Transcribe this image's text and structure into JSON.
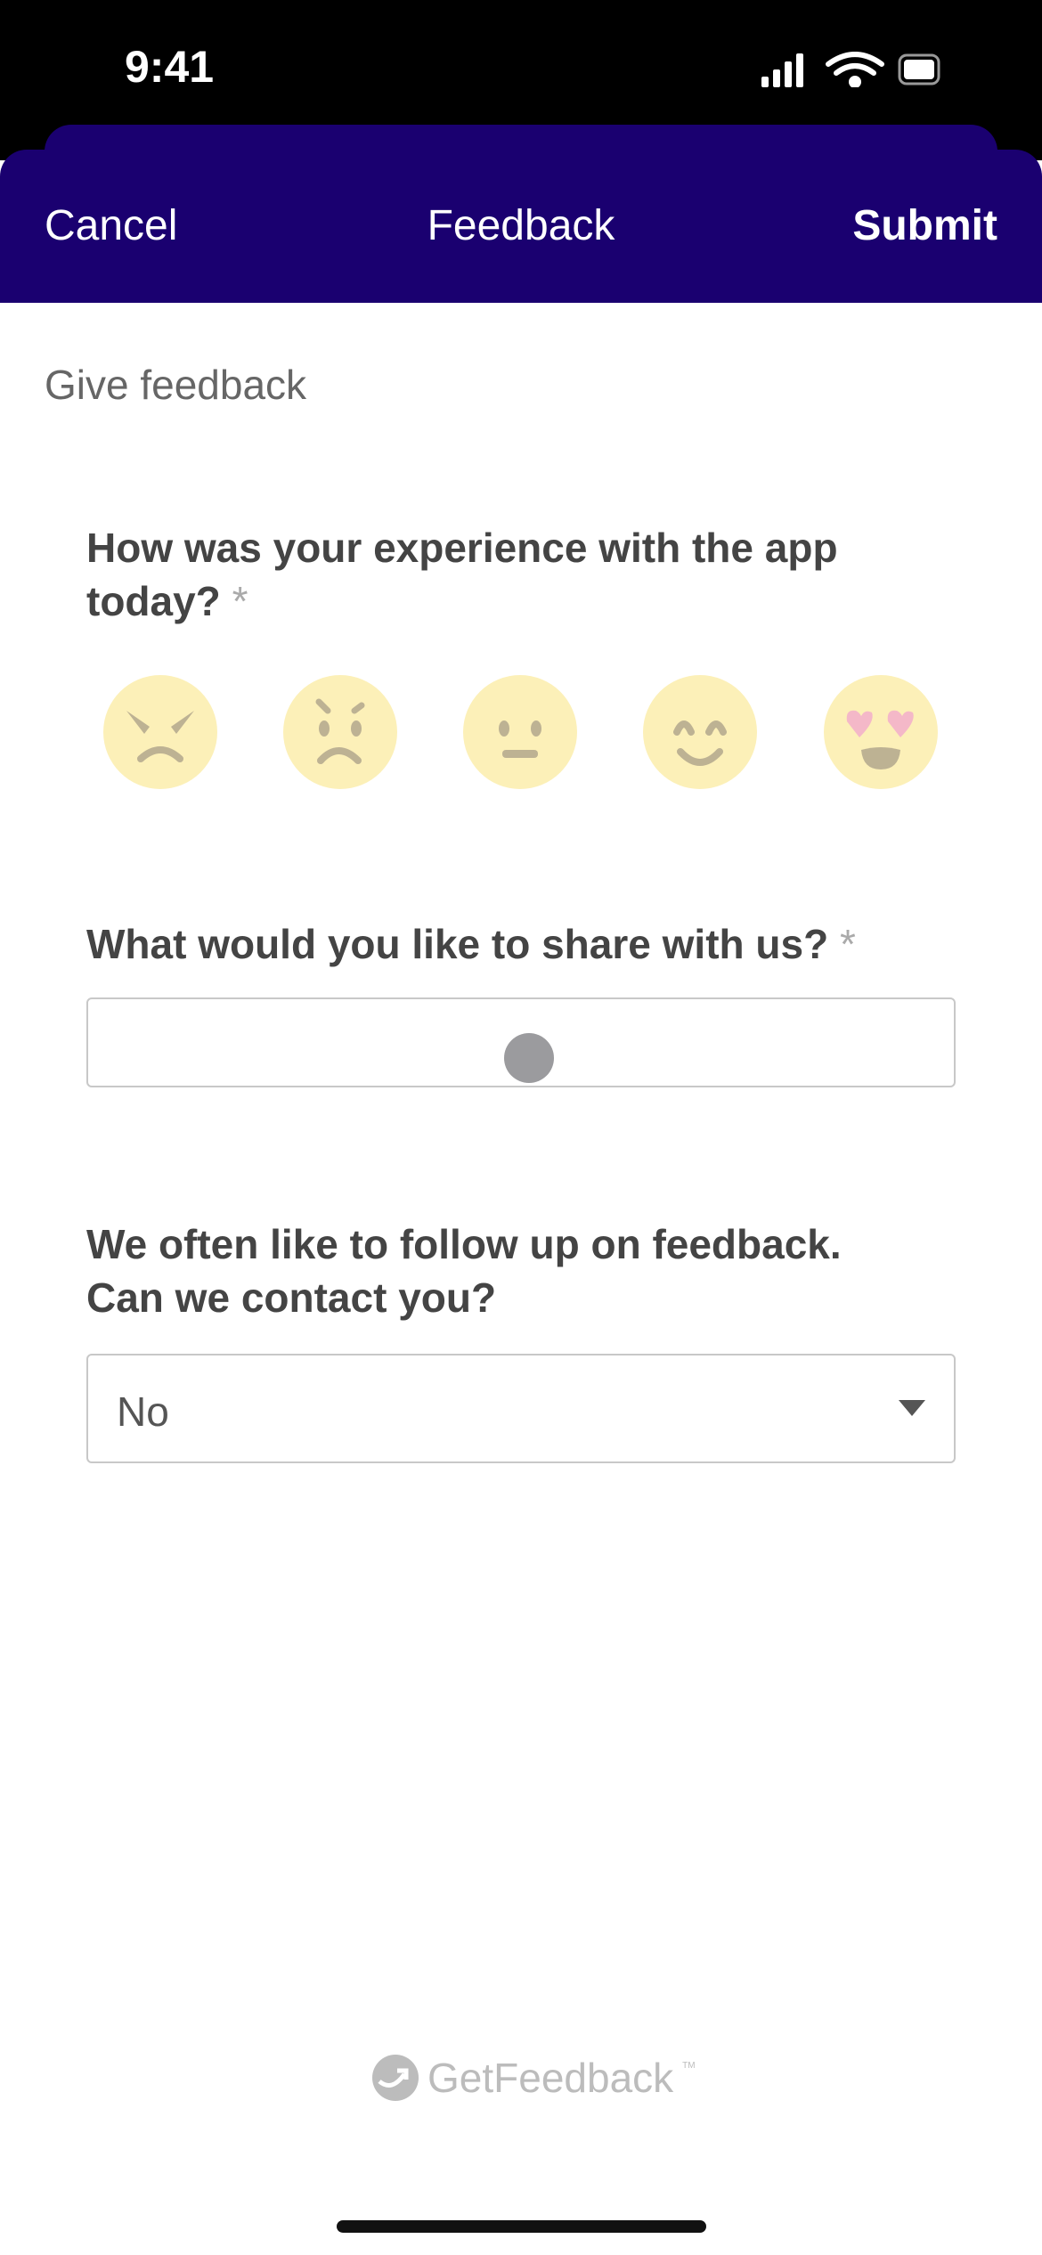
{
  "status_bar": {
    "time": "9:41",
    "icons": [
      "cellular-signal-icon",
      "wifi-icon",
      "battery-icon"
    ]
  },
  "header": {
    "cancel": "Cancel",
    "title": "Feedback",
    "submit": "Submit",
    "color": "#1a0070"
  },
  "form": {
    "heading": "Give feedback",
    "q1": {
      "label": "How was your experience with the app today?",
      "required": "*",
      "options": [
        "angry",
        "worried",
        "neutral",
        "smiling",
        "heart-eyes"
      ]
    },
    "q2": {
      "label": "What would you like to share with us?",
      "required": "*",
      "value": ""
    },
    "q3": {
      "label": "We often like to follow up on feedback. Can we contact you?",
      "selected": "No"
    }
  },
  "footer": {
    "logo": "GetFeedback",
    "tm": "TM"
  }
}
